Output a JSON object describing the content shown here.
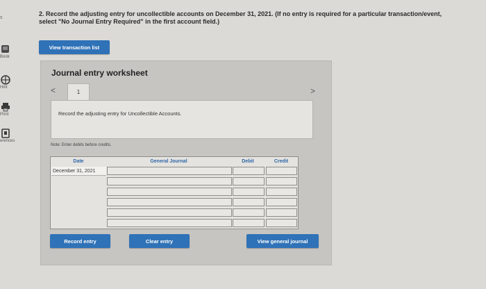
{
  "left_rail": {
    "edge_text": "s",
    "items": [
      {
        "label": "Book",
        "icon": "book-icon"
      },
      {
        "label": "Hint",
        "icon": "globe-icon"
      },
      {
        "label": "Print",
        "icon": "print-icon"
      },
      {
        "label": "erences",
        "icon": "references-icon"
      }
    ]
  },
  "question": {
    "text": "2. Record the adjusting entry for uncollectible accounts on December 31, 2021. (If no entry is required for a particular transaction/event, select \"No Journal Entry Required\" in the first account field.)"
  },
  "buttons": {
    "view_transaction_list": "View transaction list",
    "record_entry": "Record entry",
    "clear_entry": "Clear entry",
    "view_general_journal": "View general journal"
  },
  "worksheet": {
    "title": "Journal entry worksheet",
    "nav_prev": "<",
    "nav_next": ">",
    "current_tab": "1",
    "instruction": "Record the adjusting entry for Uncollectible Accounts.",
    "note": "Note: Enter debits before credits.",
    "table": {
      "headers": {
        "date": "Date",
        "general_journal": "General Journal",
        "debit": "Debit",
        "credit": "Credit"
      },
      "rows": [
        {
          "date": "December 31, 2021"
        },
        {
          "date": ""
        },
        {
          "date": ""
        },
        {
          "date": ""
        },
        {
          "date": ""
        },
        {
          "date": ""
        }
      ]
    }
  },
  "colors": {
    "button_blue": "#2f72b7",
    "header_blue": "#2f67a8",
    "panel_gray": "#c7c5c2",
    "background": "#dcdad6"
  }
}
